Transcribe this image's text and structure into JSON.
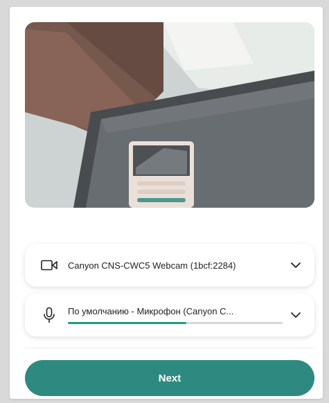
{
  "camera": {
    "device_label": "Canyon CNS-CWC5 Webcam (1bcf:2284)",
    "icon": "video-camera-icon"
  },
  "microphone": {
    "device_label": "По умолчанию - Микрофон (Canyon C...",
    "icon": "microphone-icon",
    "input_level_percent": 55
  },
  "actions": {
    "next_label": "Next"
  },
  "colors": {
    "accent": "#2e8a80",
    "meter_fill": "#1d9e83"
  }
}
